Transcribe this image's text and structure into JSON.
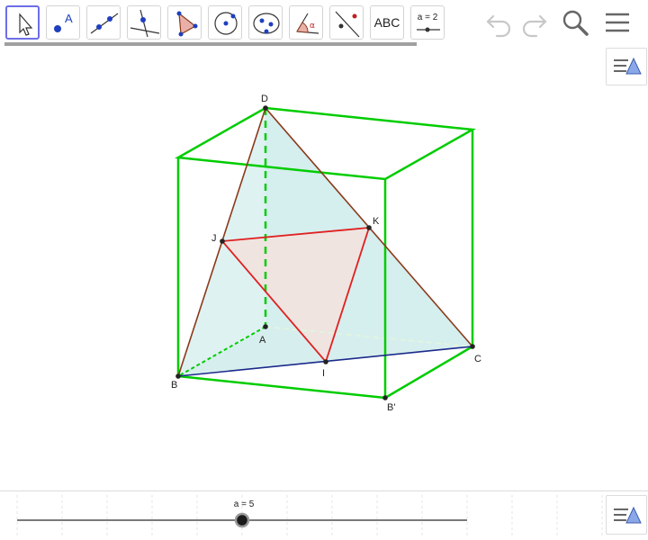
{
  "toolbar": {
    "tools": [
      {
        "id": "move",
        "icon": "arrow-pointer-icon",
        "selected": true
      },
      {
        "id": "point",
        "icon": "point-icon",
        "label": "A"
      },
      {
        "id": "line",
        "icon": "line-icon"
      },
      {
        "id": "perpendicular",
        "icon": "perpendicular-line-icon"
      },
      {
        "id": "polygon",
        "icon": "polygon-icon"
      },
      {
        "id": "circle",
        "icon": "circle-icon"
      },
      {
        "id": "conic",
        "icon": "ellipse-icon"
      },
      {
        "id": "angle",
        "icon": "angle-icon",
        "label": "α"
      },
      {
        "id": "reflect",
        "icon": "reflect-icon"
      },
      {
        "id": "text",
        "icon": "text-icon",
        "label": "ABC"
      },
      {
        "id": "slider",
        "icon": "slider-icon",
        "label": "a = 2"
      }
    ],
    "undo_icon": "undo-icon",
    "redo_icon": "redo-icon",
    "search_icon": "search-icon",
    "menu_icon": "menu-icon"
  },
  "graphics": {
    "points": {
      "D": "D",
      "A": "A",
      "B": "B",
      "C": "C",
      "Bp": "B'",
      "I": "I",
      "J": "J",
      "K": "K"
    },
    "colors": {
      "cube_edges": "#00cc00",
      "tetra_edges": "#8b3a1a",
      "base_edge": "#1a2a8a",
      "section": "#e02020",
      "face_fill": "#d8f0f0",
      "section_fill": "#efe4e0"
    }
  },
  "slider": {
    "label": "a = 5",
    "value": 5,
    "position": 0.5
  },
  "stylebar_icon": "style-bar-toggle-icon"
}
